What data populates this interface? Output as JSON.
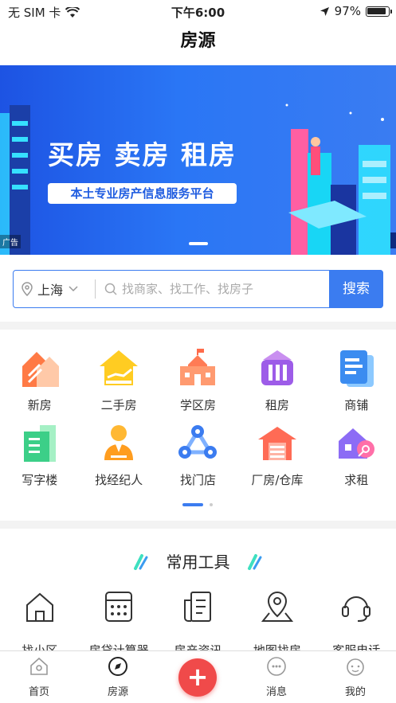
{
  "status_bar": {
    "carrier": "无 SIM 卡",
    "time": "下午6:00",
    "battery": "97%"
  },
  "nav": {
    "title": "房源"
  },
  "banner": {
    "headline": "买房 卖房 租房",
    "subline": "本土专业房产信息服务平台",
    "ad_tag": "广告"
  },
  "search": {
    "city": "上海",
    "placeholder": "找商家、找工作、找房子",
    "button": "搜索"
  },
  "categories": [
    {
      "label": "新房",
      "icon": "new-house-icon"
    },
    {
      "label": "二手房",
      "icon": "second-hand-house-icon"
    },
    {
      "label": "学区房",
      "icon": "school-district-icon"
    },
    {
      "label": "租房",
      "icon": "rent-icon"
    },
    {
      "label": "商铺",
      "icon": "shop-icon"
    },
    {
      "label": "写字楼",
      "icon": "office-building-icon"
    },
    {
      "label": "找经纪人",
      "icon": "agent-icon"
    },
    {
      "label": "找门店",
      "icon": "store-icon"
    },
    {
      "label": "厂房/仓库",
      "icon": "warehouse-icon"
    },
    {
      "label": "求租",
      "icon": "seek-rent-icon"
    }
  ],
  "tools": {
    "title": "常用工具",
    "items": [
      {
        "label": "找小区",
        "icon": "house-outline-icon"
      },
      {
        "label": "房贷计算器",
        "icon": "calculator-icon"
      },
      {
        "label": "房产资讯",
        "icon": "news-icon"
      },
      {
        "label": "地图找房",
        "icon": "map-pin-icon"
      },
      {
        "label": "客服电话",
        "icon": "headset-icon"
      }
    ]
  },
  "tabbar": {
    "items": [
      {
        "label": "首页",
        "icon": "home-icon"
      },
      {
        "label": "房源",
        "icon": "compass-icon"
      },
      {
        "label": "消息",
        "icon": "message-icon"
      },
      {
        "label": "我的",
        "icon": "profile-icon"
      }
    ],
    "fab": "+"
  },
  "colors": {
    "accent": "#3b7cf0",
    "fab": "#f04a4a",
    "banner": "#2a6cf0"
  }
}
